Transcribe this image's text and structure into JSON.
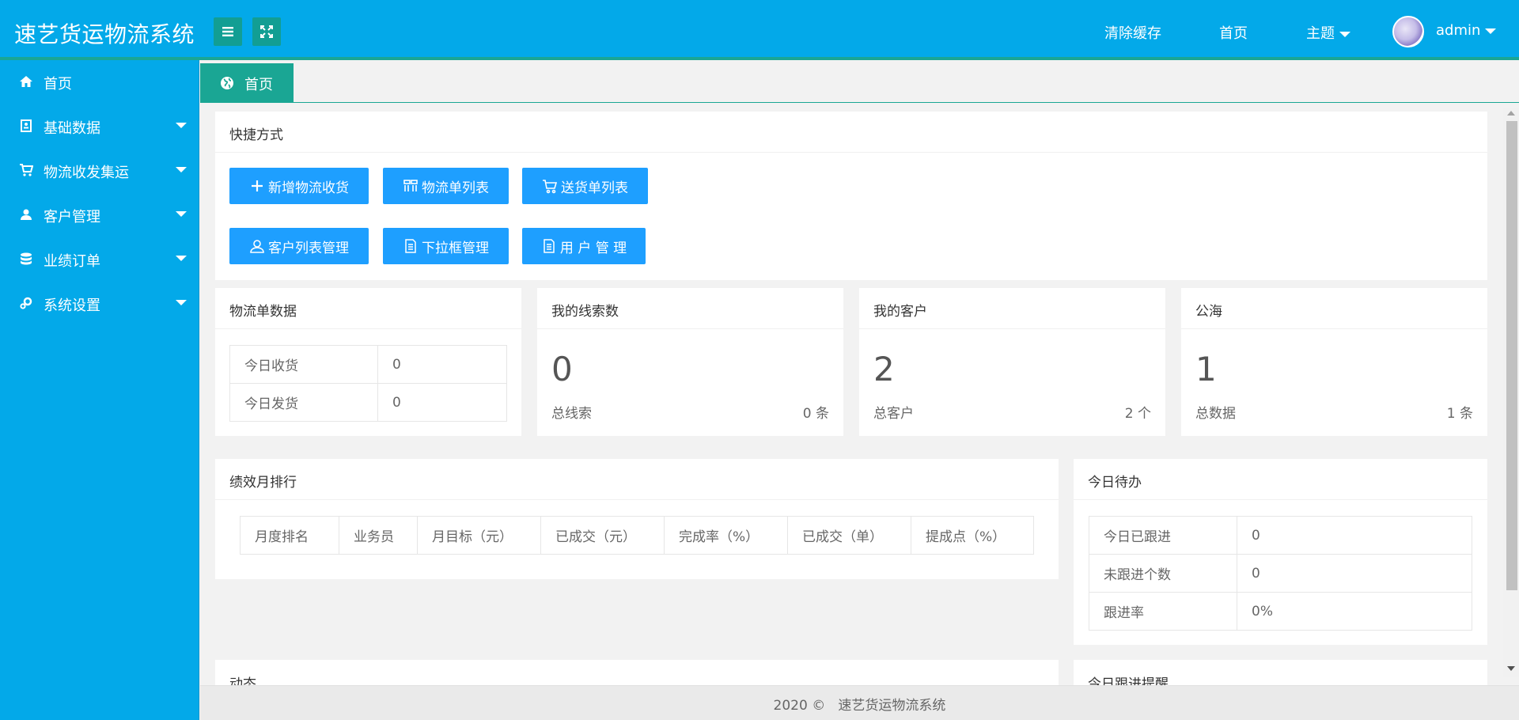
{
  "header": {
    "app_title": "速艺货运物流系统",
    "nav": {
      "clear_cache": "清除缓存",
      "home": "首页",
      "theme": "主题",
      "user": "admin"
    }
  },
  "sidebar": {
    "items": [
      {
        "label": "首页",
        "icon": "home-icon"
      },
      {
        "label": "基础数据",
        "icon": "id-card-icon"
      },
      {
        "label": "物流收发集运",
        "icon": "cart-icon"
      },
      {
        "label": "客户管理",
        "icon": "user-icon"
      },
      {
        "label": "业绩订单",
        "icon": "database-icon"
      },
      {
        "label": "系统设置",
        "icon": "gears-icon"
      }
    ]
  },
  "tabs": [
    {
      "label": "首页",
      "icon": "globe-icon",
      "active": true
    }
  ],
  "quick": {
    "title": "快捷方式",
    "buttons": [
      {
        "label": "新增物流收货",
        "icon": "plus-icon"
      },
      {
        "label": "物流单列表",
        "icon": "grid-icon"
      },
      {
        "label": "送货单列表",
        "icon": "cart-icon"
      },
      {
        "label": "客户列表管理",
        "icon": "user-icon"
      },
      {
        "label": "下拉框管理",
        "icon": "document-icon"
      },
      {
        "label": "用 户 管 理",
        "icon": "document-icon"
      }
    ]
  },
  "logistics": {
    "title": "物流单数据",
    "rows": [
      {
        "label": "今日收货",
        "value": "0"
      },
      {
        "label": "今日发货",
        "value": "0"
      }
    ]
  },
  "stats": [
    {
      "title": "我的线索数",
      "value": "0",
      "label": "总线索",
      "right": "0 条"
    },
    {
      "title": "我的客户",
      "value": "2",
      "label": "总客户",
      "right": "2 个"
    },
    {
      "title": "公海",
      "value": "1",
      "label": "总数据",
      "right": "1 条"
    }
  ],
  "ranking": {
    "title": "绩效月排行",
    "columns": [
      "月度排名",
      "业务员",
      "月目标（元）",
      "已成交（元）",
      "完成率（%）",
      "已成交（单）",
      "提成点（%）"
    ]
  },
  "todo": {
    "title": "今日待办",
    "rows": [
      {
        "label": "今日已跟进",
        "value": "0"
      },
      {
        "label": "未跟进个数",
        "value": "0"
      },
      {
        "label": "跟进率",
        "value": "0%"
      }
    ]
  },
  "partial_cards": {
    "left_title": "动态",
    "right_title": "今日跟进提醒"
  },
  "footer": {
    "text": "2020 ©   速艺货运物流系统"
  },
  "colors": {
    "brand_blue": "#03a9e9",
    "teal": "#1aa694",
    "button_blue": "#1e9fff"
  }
}
